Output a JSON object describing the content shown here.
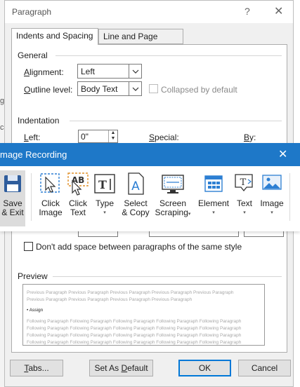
{
  "dialog": {
    "title": "Paragraph",
    "help_glyph": "?",
    "close_glyph": "✕",
    "tabs": [
      {
        "label": "Indents and Spacing",
        "active": true
      },
      {
        "label": "Line and Page Breaks",
        "active": false
      }
    ],
    "general": {
      "heading": "General",
      "alignment_label_ak": "A",
      "alignment_label_rest": "lignment:",
      "alignment_value": "Left",
      "outline_label_ak": "O",
      "outline_label_rest": "utline level:",
      "outline_value": "Body Text",
      "collapsed_label": "Collapsed by default"
    },
    "indentation": {
      "heading": "Indentation",
      "left_label_ak": "L",
      "left_label_rest": "eft:",
      "left_value": "0\"",
      "special_label_ak": "S",
      "special_label_rest": "pecial:",
      "by_label_ak": "B",
      "by_label_rest": "y:"
    },
    "spacing": {
      "dont_add_label": "Don't add space between paragraphs of the same style"
    },
    "preview": {
      "heading": "Preview",
      "previous_lines": [
        "Previous Paragraph Previous Paragraph Previous Paragraph Previous Paragraph Previous Paragraph",
        "Previous Paragraph Previous Paragraph Previous Paragraph Previous Paragraph"
      ],
      "current": "• Assign",
      "following_lines": [
        "Following Paragraph Following Paragraph Following Paragraph Following Paragraph Following Paragraph",
        "Following Paragraph Following Paragraph Following Paragraph Following Paragraph Following Paragraph",
        "Following Paragraph Following Paragraph Following Paragraph Following Paragraph Following Paragraph",
        "Following Paragraph Following Paragraph Following Paragraph Following Paragraph Following Paragraph"
      ]
    },
    "buttons": {
      "tabs_ak": "T",
      "tabs_rest": "abs...",
      "default_pre": "Set As ",
      "default_ak": "D",
      "default_rest": "efault",
      "ok": "OK",
      "cancel": "Cancel"
    }
  },
  "background_fragments": [
    "g",
    "cho"
  ],
  "image_recording": {
    "title": "mage Recording",
    "close_glyph": "✕",
    "accent_color": "#1e78c8",
    "tools": [
      {
        "line1": "Save",
        "line2": "& Exit",
        "icon": "floppy-disk-icon"
      },
      {
        "line1": "Click",
        "line2": "Image",
        "icon": "click-image-icon"
      },
      {
        "line1": "Click",
        "line2": "Text",
        "icon": "click-text-icon"
      },
      {
        "line1": "Type",
        "line2": "",
        "icon": "type-icon"
      },
      {
        "line1": "Select",
        "line2": "& Copy",
        "icon": "select-copy-icon"
      },
      {
        "line1": "Screen",
        "line2": "Scraping",
        "icon": "screen-scraping-icon"
      },
      {
        "line1": "Element",
        "line2": "",
        "icon": "element-icon"
      },
      {
        "line1": "Text",
        "line2": "",
        "icon": "text-icon"
      },
      {
        "line1": "Image",
        "line2": "",
        "icon": "image-icon"
      }
    ],
    "caret": "▾"
  }
}
